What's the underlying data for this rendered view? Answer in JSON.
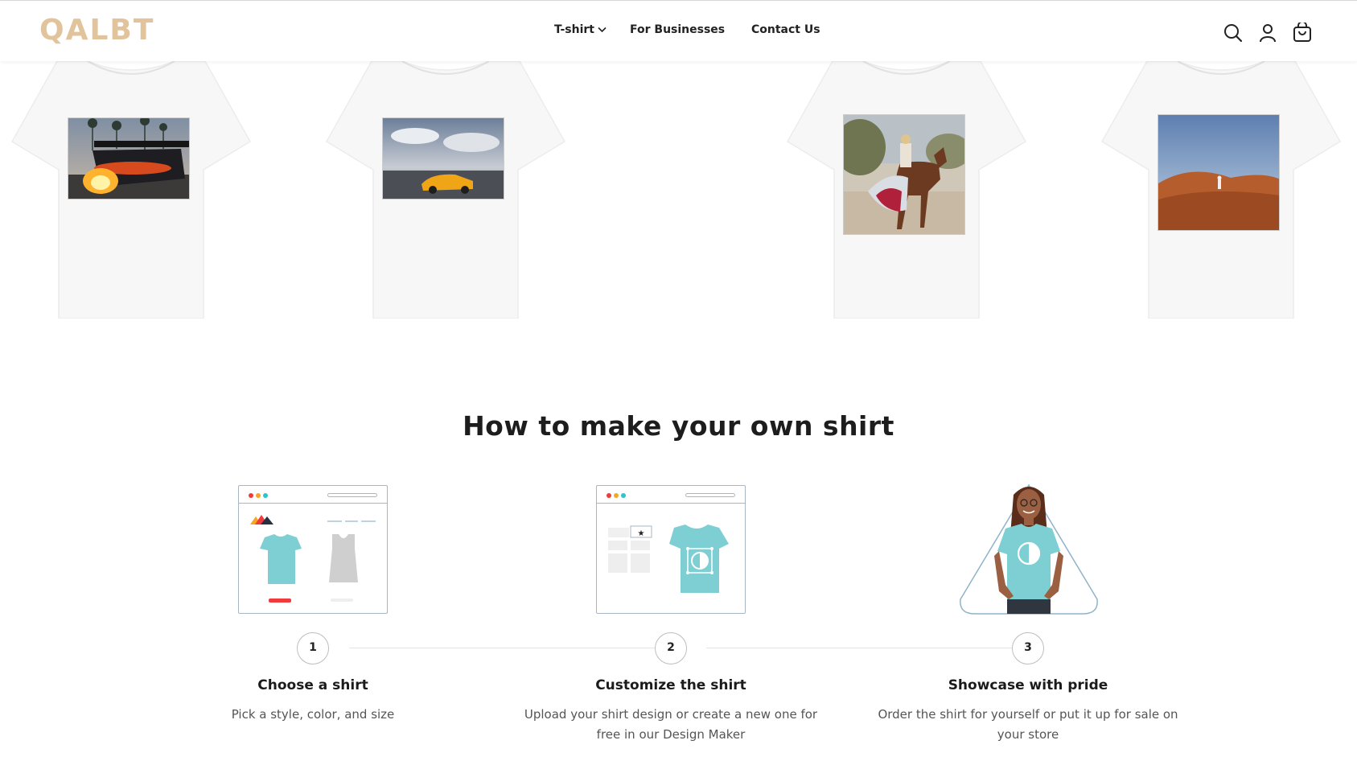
{
  "header": {
    "logo": "QALBT",
    "nav": [
      {
        "label": "T-shirt",
        "has_dropdown": true
      },
      {
        "label": "For Businesses"
      },
      {
        "label": "Contact Us"
      }
    ],
    "icons": [
      "search-icon",
      "user-icon",
      "cart-icon"
    ]
  },
  "shirts": [
    {
      "print": "race car with exhaust flames"
    },
    {
      "print": "yellow sports car under cloudy sky"
    },
    {
      "print": "rider on horse in desert"
    },
    {
      "print": "person walking on desert dunes"
    }
  ],
  "how_to": {
    "title": "How to make your own shirt",
    "steps": [
      {
        "number": "1",
        "title": "Choose a shirt",
        "description": "Pick a style, color, and size"
      },
      {
        "number": "2",
        "title": "Customize the shirt",
        "description": "Upload your shirt design or create a new one for free in our Design Maker"
      },
      {
        "number": "3",
        "title": "Showcase with pride",
        "description": "Order the shirt for yourself or put it up for sale on your store"
      }
    ]
  },
  "colors": {
    "logo": "#e1c39c",
    "accent_teal": "#7dcfd3",
    "accent_red": "#ef3b3b"
  }
}
